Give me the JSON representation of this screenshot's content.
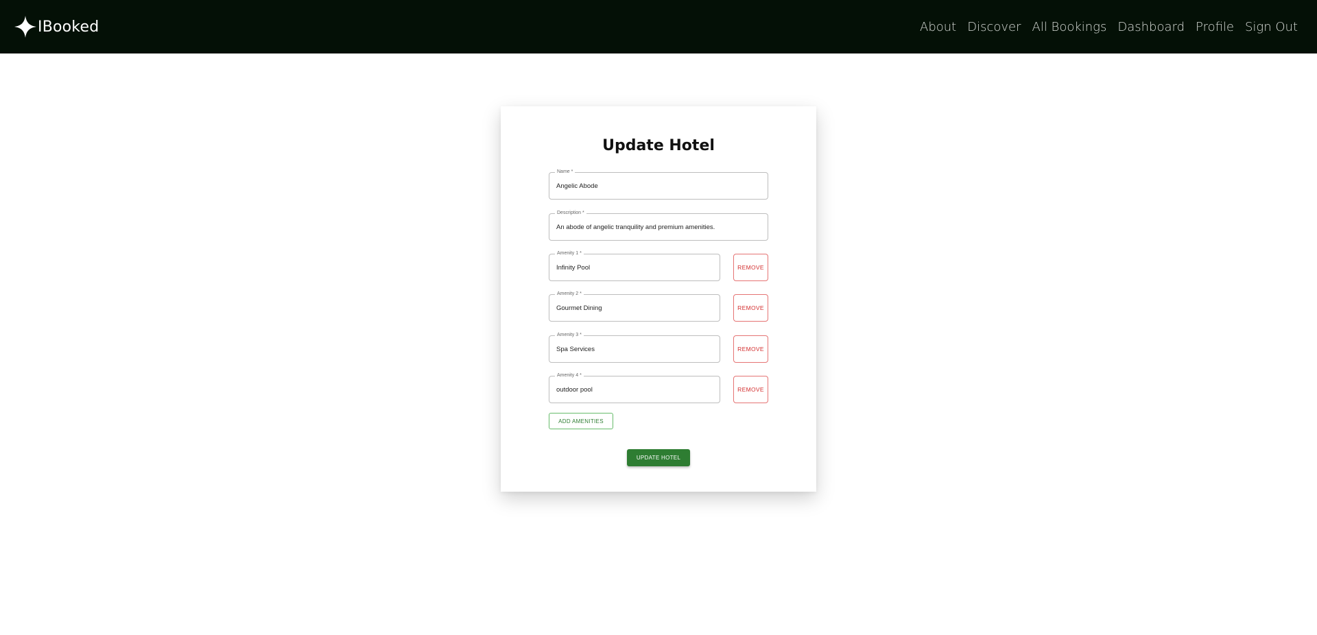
{
  "navbar": {
    "brand": "IBooked",
    "brand_icon": "four-point-star-icon",
    "links": [
      "About",
      "Discover",
      "All Bookings",
      "Dashboard",
      "Profile",
      "Sign Out"
    ]
  },
  "form": {
    "title": "Update Hotel",
    "name": {
      "label": "Name *",
      "value": "Angelic Abode"
    },
    "description": {
      "label": "Description *",
      "value": "An abode of angelic tranquility and premium amenities."
    },
    "amenities": [
      {
        "label": "Amenity 1 *",
        "value": "Infinity Pool"
      },
      {
        "label": "Amenity 2 *",
        "value": "Gourmet Dining"
      },
      {
        "label": "Amenity 3 *",
        "value": "Spa Services"
      },
      {
        "label": "Amenity 4 *",
        "value": "outdoor pool"
      }
    ],
    "remove_label": "REMOVE",
    "add_label": "ADD AMENITIES",
    "submit_label": "UPDATE HOTEL"
  },
  "colors": {
    "navbar_bg": "#041006",
    "primary_green": "#2e7d32",
    "remove_red": "#d32f2f"
  }
}
